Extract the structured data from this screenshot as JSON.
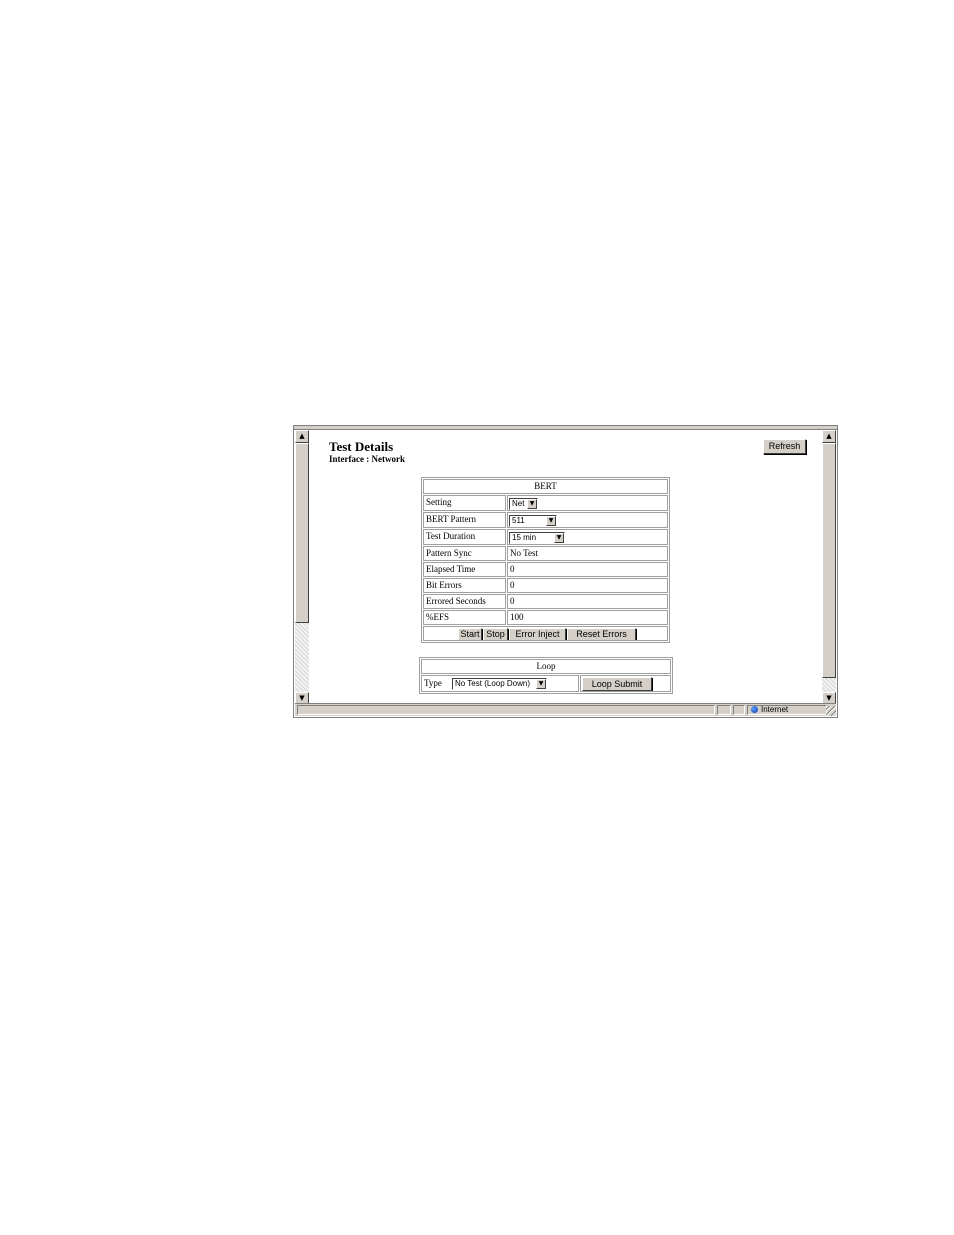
{
  "page": {
    "title": "Test Details",
    "subtitle": "Interface : Network",
    "refresh_label": "Refresh"
  },
  "bert": {
    "header": "BERT",
    "rows": [
      {
        "label": "Setting",
        "value": "Net",
        "type": "select"
      },
      {
        "label": "BERT Pattern",
        "value": "511",
        "type": "select"
      },
      {
        "label": "Test Duration",
        "value": "15 min",
        "type": "select"
      },
      {
        "label": "Pattern Sync",
        "value": "No Test",
        "type": "text"
      },
      {
        "label": "Elapsed Time",
        "value": "0",
        "type": "text"
      },
      {
        "label": "Bit Errors",
        "value": "0",
        "type": "text"
      },
      {
        "label": "Errored Seconds",
        "value": "0",
        "type": "text"
      },
      {
        "label": "%EFS",
        "value": "100",
        "type": "text"
      }
    ],
    "buttons": {
      "start": "Start",
      "stop": "Stop",
      "error_inject": "Error Inject",
      "reset_errors": "Reset Errors"
    }
  },
  "loop": {
    "header": "Loop",
    "type_label": "Type",
    "type_value": "No Test (Loop Down)",
    "submit_label": "Loop Submit"
  },
  "statusbar": {
    "zone": "Internet"
  },
  "icons": {
    "scroll_up": "▲",
    "scroll_down": "▼",
    "dropdown": "▼"
  }
}
